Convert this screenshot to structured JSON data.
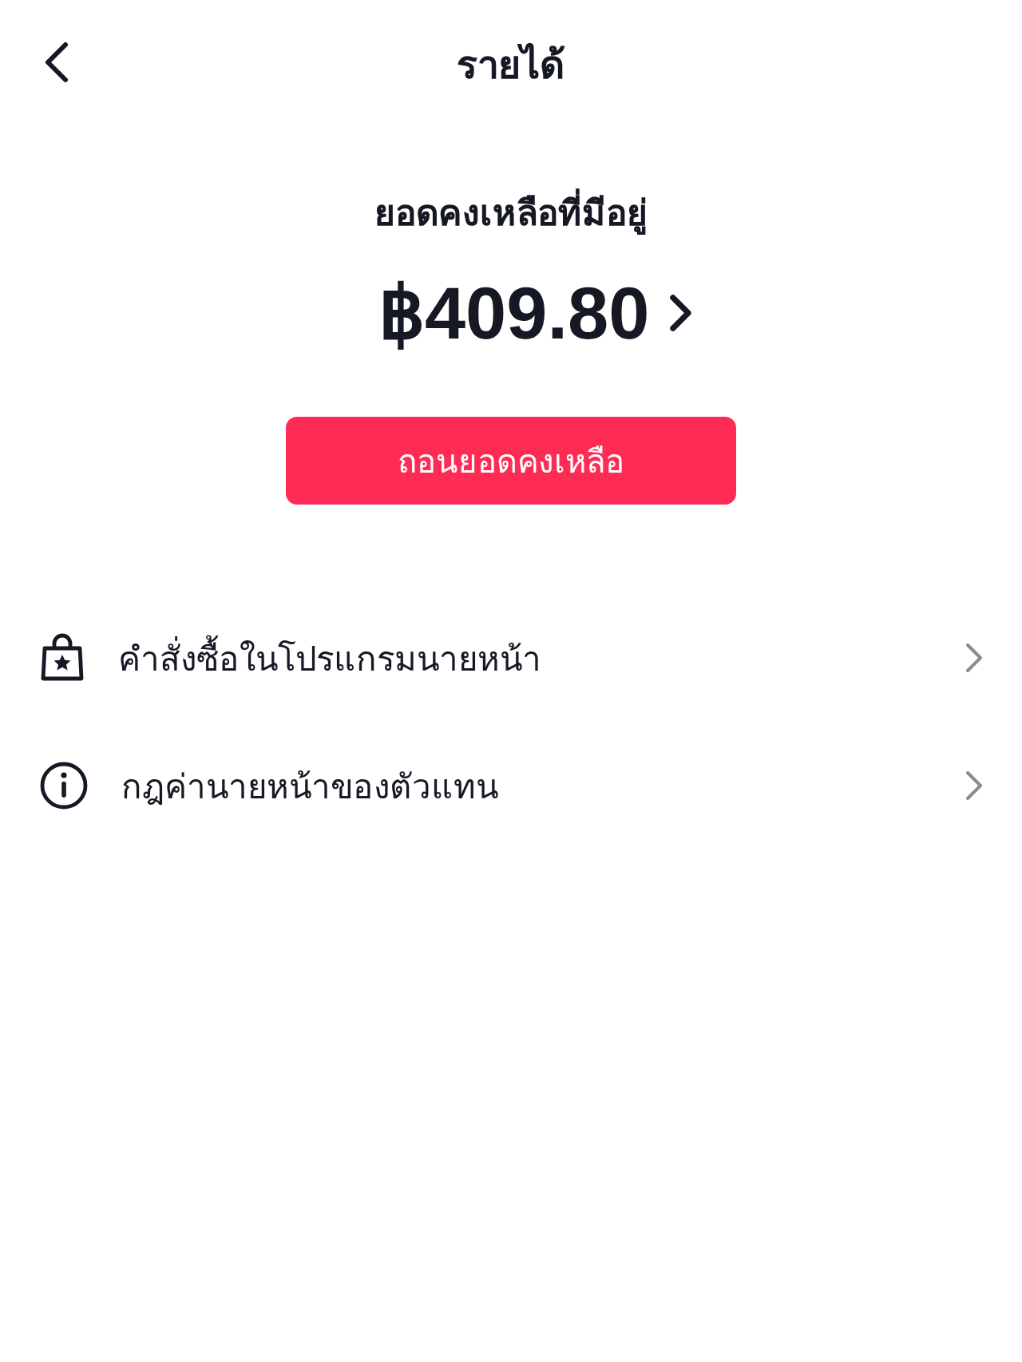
{
  "header": {
    "title": "รายได้"
  },
  "balance": {
    "label": "ยอดคงเหลือที่มีอยู่",
    "amount": "฿409.80"
  },
  "withdraw_button": {
    "label": "ถอนยอดคงเหลือ"
  },
  "menu_items": [
    {
      "kind": "bag",
      "label": "คำสั่งซื้อในโปรแกรมนายหน้า"
    },
    {
      "kind": "info",
      "label": "กฎค่านายหน้าของตัวแทน"
    }
  ]
}
